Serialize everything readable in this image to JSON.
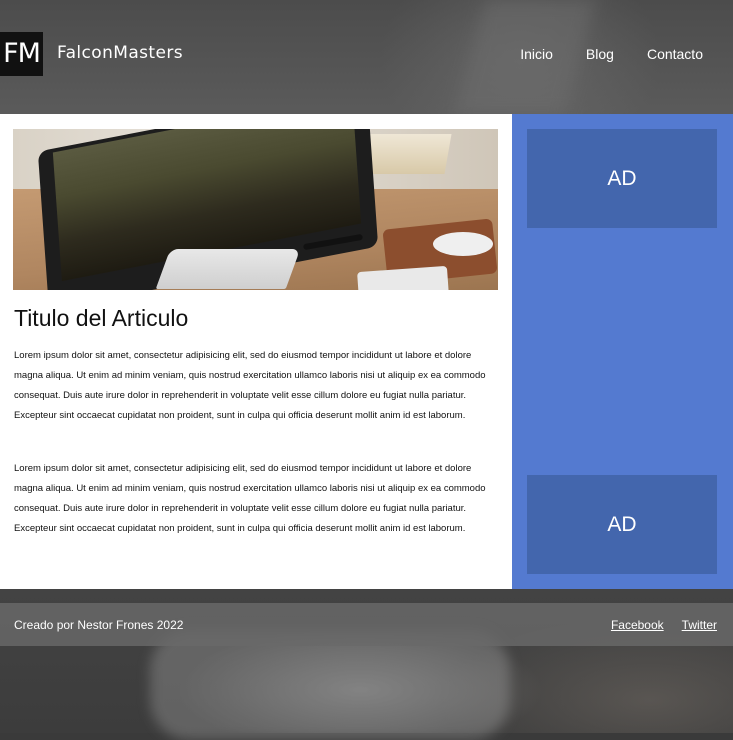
{
  "header": {
    "logo_text": "FM",
    "brand_name": "FalconMasters",
    "nav": [
      {
        "label": "Inicio"
      },
      {
        "label": "Blog"
      },
      {
        "label": "Contacto"
      }
    ]
  },
  "article": {
    "image_icon": "desk-computer-photo",
    "title": "Titulo del Articulo",
    "paragraphs": [
      "Lorem ipsum dolor sit amet, consectetur adipisicing elit, sed do eiusmod tempor incididunt ut labore et dolore magna aliqua. Ut enim ad minim veniam, quis nostrud exercitation ullamco laboris nisi ut aliquip ex ea commodo consequat. Duis aute irure dolor in reprehenderit in voluptate velit esse cillum dolore eu fugiat nulla pariatur. Excepteur sint occaecat cupidatat non proident, sunt in culpa qui officia deserunt mollit anim id est laborum.",
      "Lorem ipsum dolor sit amet, consectetur adipisicing elit, sed do eiusmod tempor incididunt ut labore et dolore magna aliqua. Ut enim ad minim veniam, quis nostrud exercitation ullamco laboris nisi ut aliquip ex ea commodo consequat. Duis aute irure dolor in reprehenderit in voluptate velit esse cillum dolore eu fugiat nulla pariatur. Excepteur sint occaecat cupidatat non proident, sunt in culpa qui officia deserunt mollit anim id est laborum."
    ]
  },
  "sidebar": {
    "ads": [
      {
        "label": "AD"
      },
      {
        "label": "AD"
      }
    ]
  },
  "footer": {
    "credit": "Creado por Nestor Frones 2022",
    "links": [
      {
        "label": "Facebook"
      },
      {
        "label": "Twitter"
      }
    ]
  },
  "colors": {
    "sidebar": "#547ad0",
    "ad_box": "#4366ad",
    "logo_bg": "#111111"
  }
}
